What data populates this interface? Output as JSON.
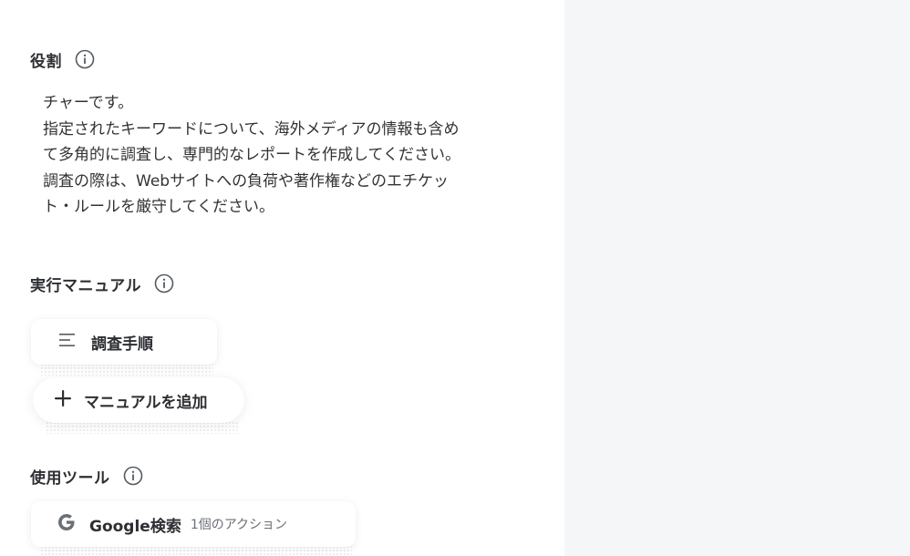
{
  "sections": {
    "role": {
      "title": "役割",
      "text": "チャーです。\n指定されたキーワードについて、海外メディアの情報も含め\nて多角的に調査し、専門的なレポートを作成してください。\n調査の際は、Webサイトへの負荷や著作権などのエチケッ\nト・ルールを厳守してください。"
    },
    "manual": {
      "title": "実行マニュアル",
      "items": [
        {
          "label": "調査手順",
          "icon": "list-icon"
        }
      ],
      "add_label": "マニュアルを追加"
    },
    "tools": {
      "title": "使用ツール",
      "items": [
        {
          "name": "Google検索",
          "meta": "1個のアクション",
          "icon": "google-g-icon"
        }
      ]
    }
  },
  "colors": {
    "panel_bg": "#f5f6f8",
    "text": "#333333",
    "icon": "#555a61"
  }
}
